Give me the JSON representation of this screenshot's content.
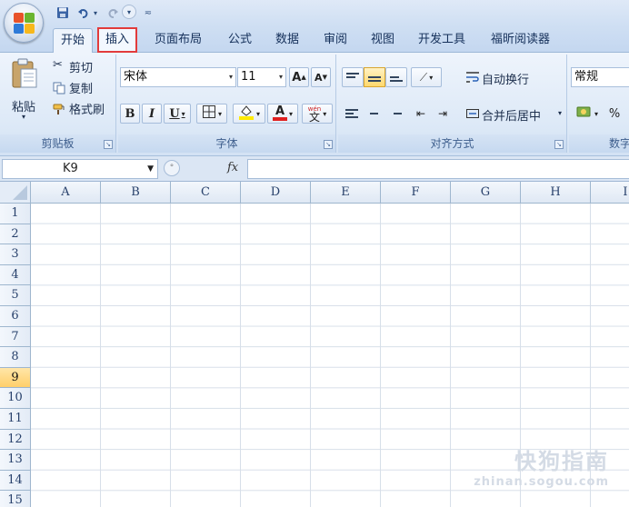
{
  "quick_access": {
    "save_icon": "save-icon",
    "undo_icon": "undo-icon",
    "redo_icon": "redo-icon",
    "customize_icon": "customize-icon"
  },
  "tabs": [
    {
      "label": "开始",
      "state": "active"
    },
    {
      "label": "插入",
      "state": "highlighted"
    },
    {
      "label": "页面布局"
    },
    {
      "label": "公式"
    },
    {
      "label": "数据"
    },
    {
      "label": "审阅"
    },
    {
      "label": "视图"
    },
    {
      "label": "开发工具"
    },
    {
      "label": "福昕阅读器"
    }
  ],
  "ribbon": {
    "clipboard": {
      "group_label": "剪贴板",
      "paste_label": "粘贴",
      "cut_label": "剪切",
      "copy_label": "复制",
      "format_painter_label": "格式刷"
    },
    "font": {
      "group_label": "字体",
      "font_name": "宋体",
      "font_size": "11",
      "bold": "B",
      "italic": "I",
      "underline": "U",
      "grow_font": "A",
      "shrink_font": "A",
      "phonetic": "wén",
      "phonetic_char": "文",
      "font_color_letter": "A",
      "font_color": "#e02020",
      "fill_color": "#ffea00"
    },
    "alignment": {
      "group_label": "对齐方式",
      "wrap_text_label": "自动换行",
      "merge_center_label": "合并后居中"
    },
    "number": {
      "format_value": "常规",
      "group_label": "数字",
      "percent": "%"
    }
  },
  "formula_bar": {
    "name_box": "K9",
    "fx_label": "fx",
    "formula": ""
  },
  "sheet": {
    "columns": [
      "A",
      "B",
      "C",
      "D",
      "E",
      "F",
      "G",
      "H",
      "I"
    ],
    "rows": [
      "1",
      "2",
      "3",
      "4",
      "5",
      "6",
      "7",
      "8",
      "9",
      "10",
      "11",
      "12",
      "13",
      "14",
      "15"
    ],
    "active_row": "9"
  },
  "watermark": {
    "title": "快狗指南",
    "url": "zhinan.sogou.com"
  },
  "colors": {
    "accent_red": "#e23b3b",
    "selected_yellow": "#ffd86d",
    "ribbon_blue": "#dde9f7"
  }
}
